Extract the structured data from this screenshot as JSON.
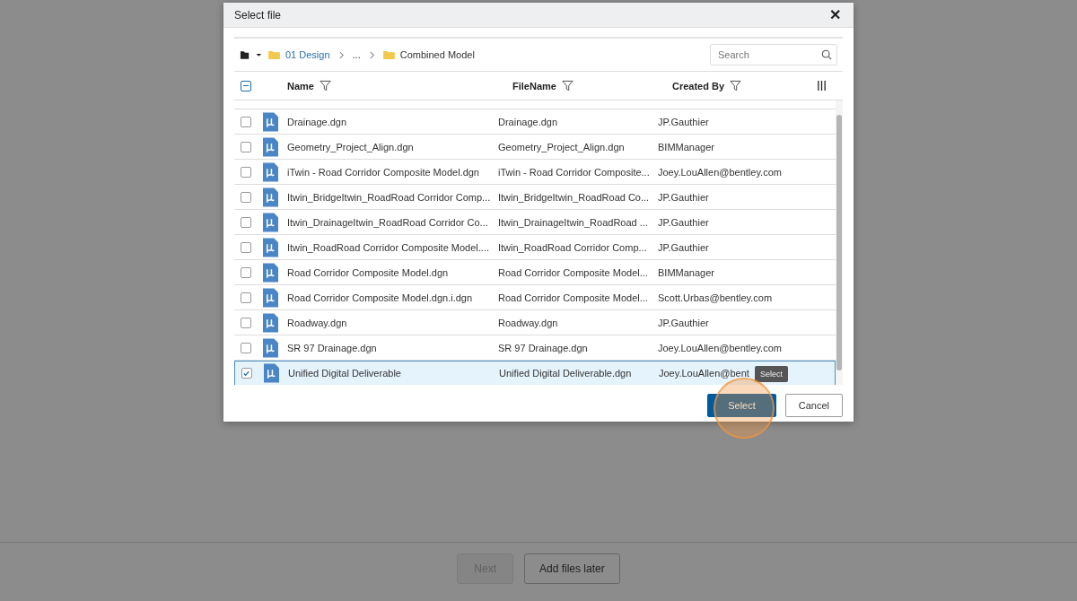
{
  "dialog": {
    "title": "Select file",
    "close": "✕"
  },
  "breadcrumb": [
    {
      "label": "01 Design",
      "kind": "link"
    },
    {
      "label": "...",
      "kind": "ellipsis"
    },
    {
      "label": "Combined Model",
      "kind": "current"
    }
  ],
  "search": {
    "placeholder": "Search"
  },
  "table": {
    "select_all": {
      "indeterminate": true
    },
    "columns": [
      {
        "label": "Name",
        "filter": true
      },
      {
        "label": "FileName",
        "filter": true
      },
      {
        "label": "Created By",
        "filter": true
      }
    ],
    "rows": [
      {
        "name": "Drainage.dgn",
        "file_name": "Drainage.dgn",
        "created_by": "JP.Gauthier",
        "selected": false
      },
      {
        "name": "Geometry_Project_Align.dgn",
        "file_name": "Geometry_Project_Align.dgn",
        "created_by": "BIMManager",
        "selected": false
      },
      {
        "name": "iTwin - Road Corridor Composite Model.dgn",
        "file_name": "iTwin - Road Corridor Composite...",
        "created_by": "Joey.LouAllen@bentley.com",
        "selected": false
      },
      {
        "name": "Itwin_BridgeItwin_RoadRoad Corridor Comp...",
        "file_name": "Itwin_BridgeItwin_RoadRoad Co...",
        "created_by": "JP.Gauthier",
        "selected": false
      },
      {
        "name": "Itwin_DrainageItwin_RoadRoad Corridor Co...",
        "file_name": "Itwin_DrainageItwin_RoadRoad ...",
        "created_by": "JP.Gauthier",
        "selected": false
      },
      {
        "name": "Itwin_RoadRoad Corridor Composite Model....",
        "file_name": "Itwin_RoadRoad Corridor Comp...",
        "created_by": "JP.Gauthier",
        "selected": false
      },
      {
        "name": "Road Corridor Composite Model.dgn",
        "file_name": "Road Corridor Composite Model...",
        "created_by": "BIMManager",
        "selected": false
      },
      {
        "name": "Road Corridor Composite Model.dgn.i.dgn",
        "file_name": "Road Corridor Composite Model...",
        "created_by": "Scott.Urbas@bentley.com",
        "selected": false
      },
      {
        "name": "Roadway.dgn",
        "file_name": "Roadway.dgn",
        "created_by": "JP.Gauthier",
        "selected": false
      },
      {
        "name": "SR 97 Drainage.dgn",
        "file_name": "SR 97 Drainage.dgn",
        "created_by": "Joey.LouAllen@bentley.com",
        "selected": false
      },
      {
        "name": "Unified Digital Deliverable",
        "file_name": "Unified Digital Deliverable.dgn",
        "created_by": "Joey.LouAllen@bent",
        "selected": true
      }
    ]
  },
  "tooltip": "Select",
  "buttons": [
    {
      "label": "Select",
      "kind": "primary"
    },
    {
      "label": "Cancel",
      "kind": "secondary"
    }
  ],
  "footer_buttons": [
    {
      "label": "Next",
      "disabled": true
    },
    {
      "label": "Add files later",
      "disabled": false
    }
  ]
}
